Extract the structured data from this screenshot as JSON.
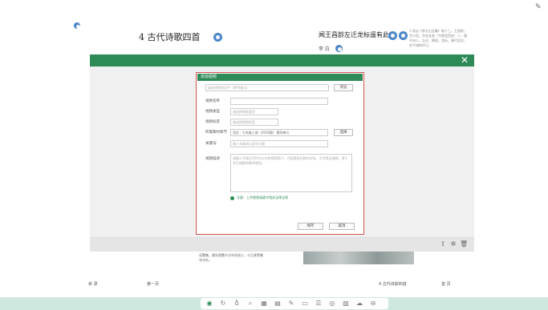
{
  "page": {
    "title": "4 古代诗歌四首",
    "poem_title": "闻王昌龄左迁龙标遥有此寄",
    "poem_author": "李 白",
    "notes_text": "1.选自《李太白全集》卷十三。王昌龄，字少伯，京兆长安（今陕西西安）人，唐代诗人。左迁，降职。龙标，唐代县名，在今湖南洪江。",
    "caption_text": "诺整集。唐先理整众分年间进士，与王维等集年诗名。",
    "nav": {
      "prev_label": "目 录",
      "left_page": "第一页",
      "right_section": "4 古代诗歌四首",
      "next_label": "首 页"
    }
  },
  "overlay": {
    "close_icon": "close-icon",
    "footer_icons": [
      "share-icon",
      "settings-icon",
      "delete-icon"
    ]
  },
  "dialog": {
    "title": "添加视频",
    "upload_placeholder": "请选择视频文件（MP4格式）",
    "browse_button": "浏览",
    "name_label": "视频名称",
    "name_value": "",
    "category_label": "视频类型",
    "category_placeholder": "请选择视频类型",
    "tag_label": "视频标签",
    "tag_placeholder": "请选择视频标签",
    "source_label": "所属教材章节",
    "source_value": "语文 · 七年级上册（2016版）· 第四单元",
    "select_button": "选择",
    "keyword_label": "关键词",
    "keyword_placeholder": "输入关键词以逗号分隔",
    "desc_label": "视频描述",
    "desc_placeholder": "请输入不超过500字以内的视频简介，内容要贴近教学实际，文字简洁通顺，便于学生理解和教师使用。",
    "tip_text": "注意：上传视频请遵守相关法律法规",
    "confirm_button": "保存",
    "cancel_button": "取消"
  },
  "toolbar": {
    "items": [
      "home-icon",
      "refresh-icon",
      "pen-icon",
      "search-icon",
      "grid-icon",
      "board-icon",
      "brush-icon",
      "screen-icon",
      "list-icon",
      "camera-icon",
      "image-icon",
      "cloud-icon",
      "minus-icon"
    ],
    "glyphs": [
      "◉",
      "↻",
      "♁",
      "⌕",
      "▦",
      "▤",
      "✎",
      "▭",
      "☰",
      "◎",
      "▨",
      "☁",
      "⊖"
    ]
  }
}
